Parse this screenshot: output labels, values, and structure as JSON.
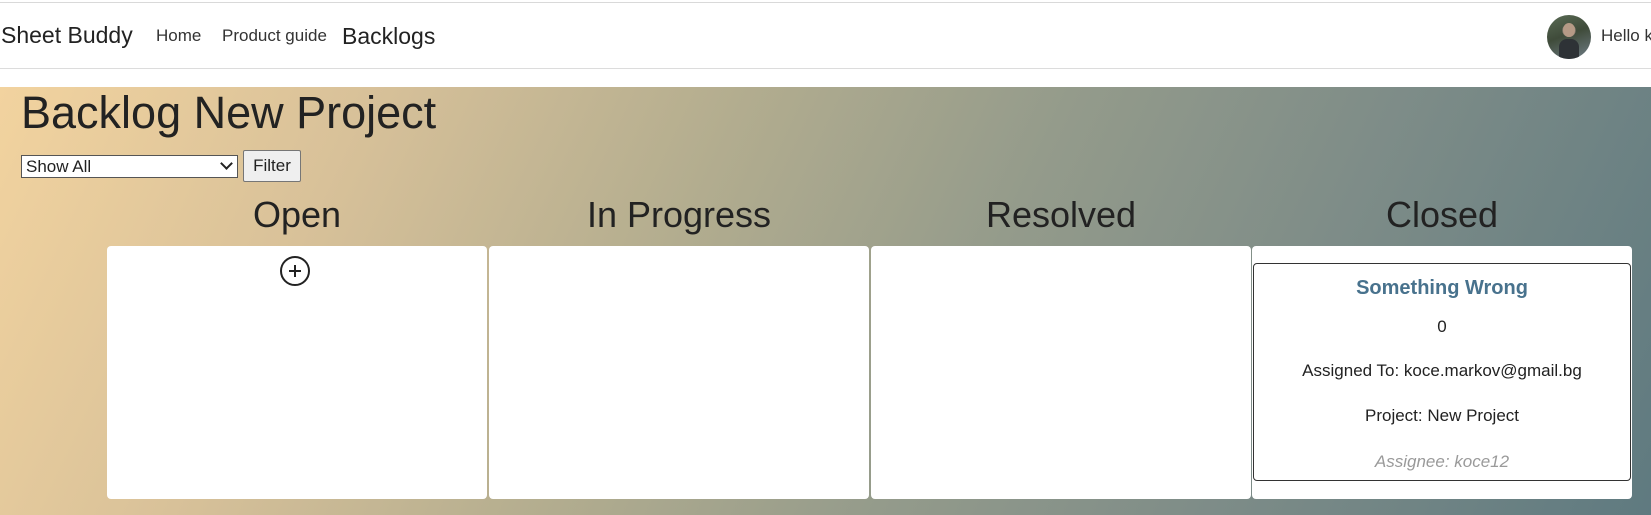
{
  "navbar": {
    "brand": "Sheet Buddy",
    "links": {
      "home": "Home",
      "product_guide": "Product guide",
      "backlogs": "Backlogs"
    },
    "greeting": "Hello k"
  },
  "page": {
    "title": "Backlog New Project",
    "filter": {
      "selected": "Show All",
      "button_label": "Filter"
    }
  },
  "columns": [
    {
      "title": "Open"
    },
    {
      "title": "In Progress"
    },
    {
      "title": "Resolved"
    },
    {
      "title": "Closed"
    }
  ],
  "cards": {
    "closed": [
      {
        "title": "Something Wrong",
        "points": "0",
        "assigned_to": "Assigned To: koce.markov@gmail.bg",
        "project": "Project: New Project",
        "assignee": "Assignee: koce12"
      }
    ]
  },
  "icons": {
    "add": "plus-circle-icon",
    "dropdown": "chevron-down-icon"
  },
  "colors": {
    "card_title": "#48728d",
    "background_start": "#f2d39f",
    "background_end": "#5f7a80"
  }
}
